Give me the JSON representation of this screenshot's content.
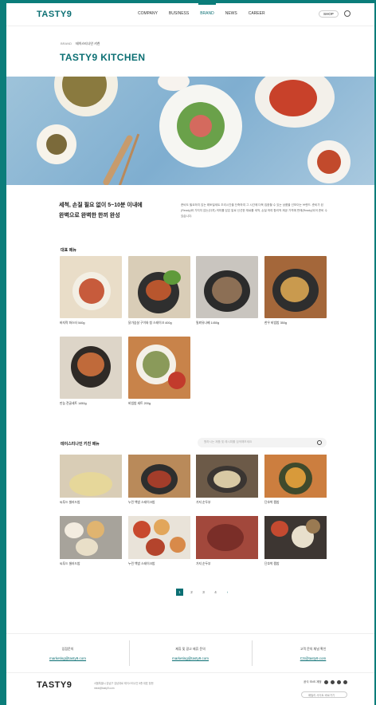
{
  "header": {
    "logo": "TASTY9",
    "nav": [
      "COMPANY",
      "BUSINESS",
      "BRAND",
      "NEWS",
      "CAREER"
    ],
    "active_nav": "BRAND",
    "shop_label": "SHOP"
  },
  "breadcrumb": [
    "BRAND",
    "테이스티나인 키친"
  ],
  "page_title": "TASTY9 KITCHEN",
  "intro": {
    "headline_1": "세척, 손질 필요 없이 5~10분 이내에",
    "headline_2": "완벽으로 완벽한 한끼 완성",
    "body": "준비도 필요하지 않는 레토밀세트 조리시간을 단축하여 그 시간에 더욱 집중할 수 있는 상품을 선보이는 브랜드. 준비가 된 (Ready)와 가지지 않는(다치) 의미를 담은 말로 신선한 재료를 세척, 손질 하여 합리적 제공 가격에 판매(Ready)되어 준비 수 있습니다."
  },
  "rep_menu": {
    "title": "대표 메뉴",
    "items": [
      "바지락 파스타 540g",
      "닭가슴살 구이와 청 스테이크 400g",
      "밀푀유나베 1450g",
      "한우 비빔밥 350g",
      "만능 전골세트 1450g",
      "비빔밥 세트 200g"
    ]
  },
  "kitchen": {
    "title": "테이스티나인 키친 메뉴",
    "search_placeholder": "원하시는 제품 및 레시피를 검색해보세요",
    "items": [
      "씨푸드 샐러드밥",
      "누린 백밥 스테이크밥",
      "가지 순두부",
      "단호박 찜밥",
      "씨푸드 샐러드밥",
      "누린 백밥 스테이크밥",
      "가지 순두부",
      "단호박 찜밥"
    ]
  },
  "pagination": {
    "pages": [
      "1",
      "2",
      "3",
      "4"
    ],
    "active": "1",
    "next": "›"
  },
  "contact": [
    {
      "title": "입점문의",
      "email": "marketing@tasty9.com"
    },
    {
      "title": "제휴 및 광고 제휴 문의",
      "email": "marketing@tasty9.com"
    },
    {
      "title": "고객 문의 채널 확인",
      "email": "CS@tasty9.com"
    }
  ],
  "footer": {
    "logo": "TASTY9",
    "info_1": "서울특별시 강남구 강남대로 테이스티나인 5층 대표 정현",
    "info_2": "mirai@tasty9.com",
    "social_label": "공식 SNS 계정",
    "family_site": "패밀리 사이트 바로가기"
  },
  "colors": {
    "brand": "#0b6f73",
    "frame": "#0b7d7a"
  }
}
